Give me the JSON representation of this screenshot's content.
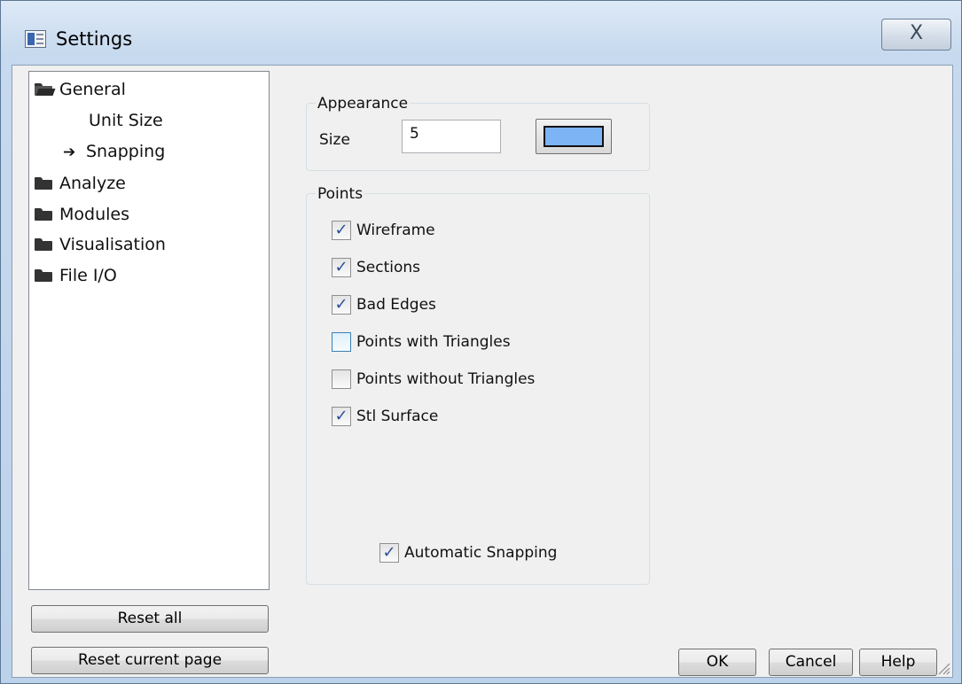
{
  "window": {
    "title": "Settings",
    "close_glyph": "X",
    "app_icon": "window-settings-icon"
  },
  "tree": {
    "items": [
      {
        "label": "General",
        "icon": "folder-open-icon"
      },
      {
        "label": "Unit Size",
        "icon": ""
      },
      {
        "label": "Snapping",
        "icon": "arrow-right-icon",
        "selected": true
      },
      {
        "label": "Analyze",
        "icon": "folder-icon"
      },
      {
        "label": "Modules",
        "icon": "folder-icon"
      },
      {
        "label": "Visualisation",
        "icon": "folder-icon"
      },
      {
        "label": "File I/O",
        "icon": "folder-icon"
      }
    ],
    "arrow_glyph": "➔"
  },
  "left_buttons": {
    "reset_all": "Reset all",
    "reset_current_page": "Reset current page"
  },
  "appearance": {
    "group_label": "Appearance",
    "size_label": "Size",
    "size_value": "5",
    "color": "#7cb4f5"
  },
  "points": {
    "group_label": "Points",
    "options": [
      {
        "label": "Wireframe",
        "checked": true
      },
      {
        "label": "Sections",
        "checked": true
      },
      {
        "label": "Bad Edges",
        "checked": true
      },
      {
        "label": "Points with Triangles",
        "checked": false
      },
      {
        "label": "Points without Triangles",
        "checked": false
      },
      {
        "label": "Stl Surface",
        "checked": true
      }
    ],
    "automatic_snapping": {
      "label": "Automatic Snapping",
      "checked": true
    },
    "check_glyph": "✓"
  },
  "dialog_buttons": {
    "ok": "OK",
    "cancel": "Cancel",
    "help": "Help"
  },
  "colors": {
    "accent": "#3c7fb1",
    "check": "#2b4f9c"
  }
}
